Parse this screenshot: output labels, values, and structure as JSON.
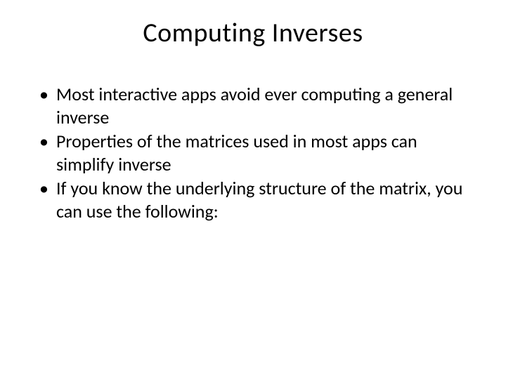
{
  "slide": {
    "title": "Computing Inverses",
    "bullets": [
      "Most interactive apps avoid ever computing a general inverse",
      "Properties of the matrices used in most apps can simplify inverse",
      "If you know the underlying structure of the matrix, you can use the following:"
    ]
  }
}
